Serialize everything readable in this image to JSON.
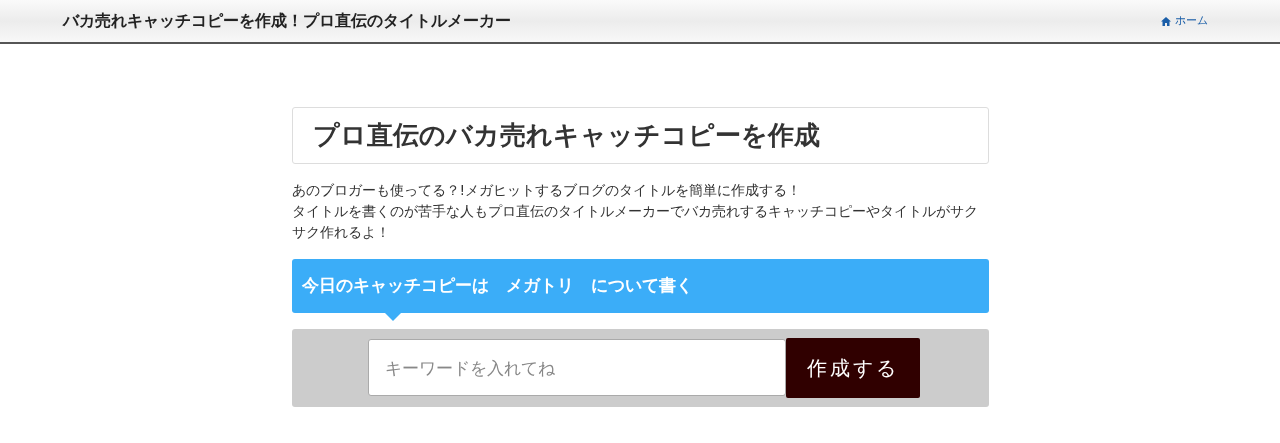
{
  "header": {
    "site_title": "バカ売れキャッチコピーを作成！プロ直伝のタイトルメーカー",
    "nav": [
      {
        "label": "ホーム"
      }
    ]
  },
  "heading": "プロ直伝のバカ売れキャッチコピーを作成",
  "description": [
    "あのブロガーも使ってる？!メガヒットするブログのタイトルを簡単に作成する！",
    "タイトルを書くのが苦手な人もプロ直伝のタイトルメーカーでバカ売れするキャッチコピーやタイトルがサクサク作れるよ！"
  ],
  "banner": "今日のキャッチコピーは　メガトリ　について書く",
  "form": {
    "placeholder": "キーワードを入れてね",
    "button": "作成する"
  }
}
